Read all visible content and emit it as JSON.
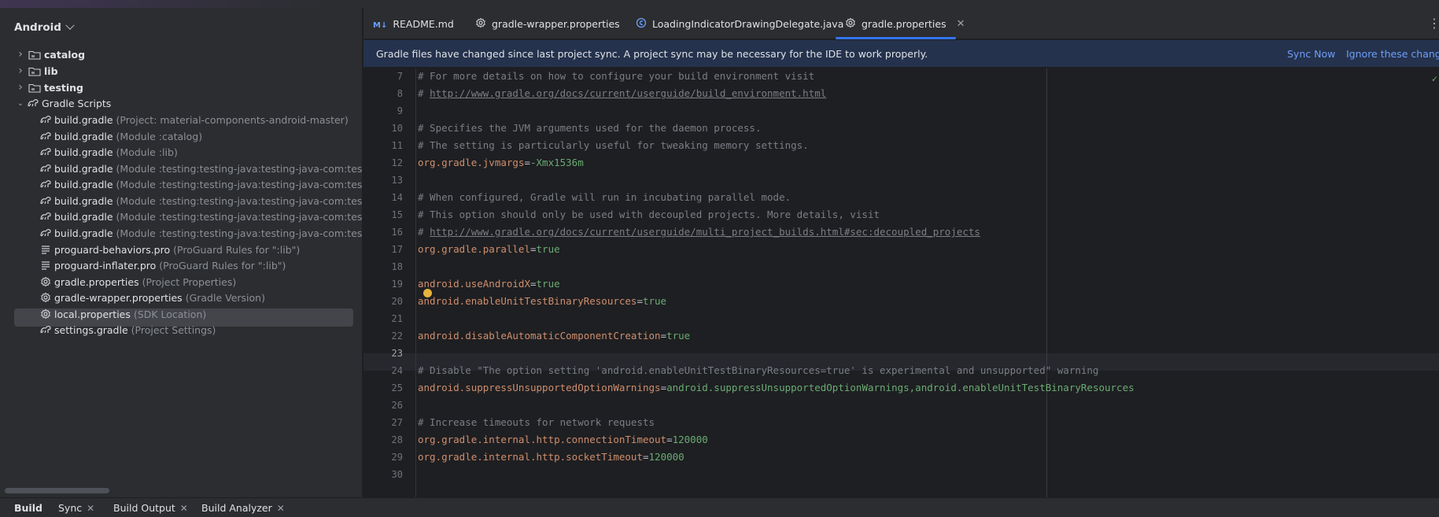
{
  "sidebar": {
    "view_label": "Android",
    "items": [
      {
        "name": "catalog",
        "hint": "",
        "kind": "folder"
      },
      {
        "name": "lib",
        "hint": "",
        "kind": "folder"
      },
      {
        "name": "testing",
        "hint": "",
        "kind": "folder"
      },
      {
        "name": "Gradle Scripts",
        "hint": "",
        "kind": "gradle-group"
      },
      {
        "name": "build.gradle",
        "hint": "(Project: material-components-android-master)",
        "kind": "gradle"
      },
      {
        "name": "build.gradle",
        "hint": "(Module :catalog)",
        "kind": "gradle"
      },
      {
        "name": "build.gradle",
        "hint": "(Module :lib)",
        "kind": "gradle"
      },
      {
        "name": "build.gradle",
        "hint": "(Module :testing:testing-java:testing-java-com:testing-java-",
        "kind": "gradle"
      },
      {
        "name": "build.gradle",
        "hint": "(Module :testing:testing-java:testing-java-com:testing-java-",
        "kind": "gradle"
      },
      {
        "name": "build.gradle",
        "hint": "(Module :testing:testing-java:testing-java-com:testing-java-",
        "kind": "gradle"
      },
      {
        "name": "build.gradle",
        "hint": "(Module :testing:testing-java:testing-java-com:testing-java-",
        "kind": "gradle"
      },
      {
        "name": "build.gradle",
        "hint": "(Module :testing:testing-java:testing-java-com:testing-java-",
        "kind": "gradle"
      },
      {
        "name": "proguard-behaviors.pro",
        "hint": "(ProGuard Rules for \":lib\")",
        "kind": "text"
      },
      {
        "name": "proguard-inflater.pro",
        "hint": "(ProGuard Rules for \":lib\")",
        "kind": "text"
      },
      {
        "name": "gradle.properties",
        "hint": "(Project Properties)",
        "kind": "settings"
      },
      {
        "name": "gradle-wrapper.properties",
        "hint": "(Gradle Version)",
        "kind": "settings"
      },
      {
        "name": "local.properties",
        "hint": "(SDK Location)",
        "kind": "settings"
      },
      {
        "name": "settings.gradle",
        "hint": "(Project Settings)",
        "kind": "gradle"
      }
    ],
    "selected_item": "gradle.properties"
  },
  "tabs": [
    {
      "label": "README.md",
      "icon": "markdown-icon",
      "active": false,
      "closable": false
    },
    {
      "label": "gradle-wrapper.properties",
      "icon": "settings-gear-icon",
      "active": false,
      "closable": false
    },
    {
      "label": "LoadingIndicatorDrawingDelegate.java",
      "icon": "java-class-icon",
      "active": false,
      "closable": false
    },
    {
      "label": "gradle.properties",
      "icon": "settings-gear-icon",
      "active": true,
      "closable": true
    }
  ],
  "banner": {
    "message": "Gradle files have changed since last project sync. A project sync may be necessary for the IDE to work properly.",
    "sync_now": "Sync Now",
    "ignore": "Ignore these changes"
  },
  "editor": {
    "current_line": 23,
    "lines": [
      {
        "n": "7",
        "segments": [
          [
            "c-comment",
            "# For more details on how to configure your build environment visit"
          ]
        ]
      },
      {
        "n": "8",
        "segments": [
          [
            "c-comment",
            "# "
          ],
          [
            "c-url",
            "http://www.gradle.org/docs/current/userguide/build_environment.html"
          ]
        ]
      },
      {
        "n": "9",
        "segments": []
      },
      {
        "n": "10",
        "segments": [
          [
            "c-comment",
            "# Specifies the JVM arguments used for the daemon process."
          ]
        ]
      },
      {
        "n": "11",
        "segments": [
          [
            "c-comment",
            "# The setting is particularly useful for tweaking memory settings."
          ]
        ]
      },
      {
        "n": "12",
        "segments": [
          [
            "c-key",
            "org.gradle.jvmargs"
          ],
          [
            "c-eq",
            "="
          ],
          [
            "c-val",
            "-Xmx1536m"
          ]
        ]
      },
      {
        "n": "13",
        "segments": []
      },
      {
        "n": "14",
        "segments": [
          [
            "c-comment",
            "# When configured, Gradle will run in incubating parallel mode."
          ]
        ]
      },
      {
        "n": "15",
        "segments": [
          [
            "c-comment",
            "# This option should only be used with decoupled projects. More details, visit"
          ]
        ]
      },
      {
        "n": "16",
        "segments": [
          [
            "c-comment",
            "# "
          ],
          [
            "c-url",
            "http://www.gradle.org/docs/current/userguide/multi_project_builds.html#sec:decoupled_projects"
          ]
        ]
      },
      {
        "n": "17",
        "segments": [
          [
            "c-key",
            "org.gradle.parallel"
          ],
          [
            "c-eq",
            "="
          ],
          [
            "c-val",
            "true"
          ]
        ]
      },
      {
        "n": "18",
        "segments": []
      },
      {
        "n": "19",
        "segments": [
          [
            "c-key",
            "android.useAndroidX"
          ],
          [
            "c-eq",
            "="
          ],
          [
            "c-val",
            "true"
          ]
        ]
      },
      {
        "n": "20",
        "segments": [
          [
            "c-key",
            "android.enableUnitTestBinaryResources"
          ],
          [
            "c-eq",
            "="
          ],
          [
            "c-val",
            "true"
          ]
        ]
      },
      {
        "n": "21",
        "segments": []
      },
      {
        "n": "22",
        "segments": [
          [
            "c-key",
            "android.disableAutomaticComponentCreation"
          ],
          [
            "c-eq",
            "="
          ],
          [
            "c-val",
            "true"
          ]
        ]
      },
      {
        "n": "23",
        "segments": []
      },
      {
        "n": "24",
        "segments": [
          [
            "c-comment",
            "# Disable \"The option setting 'android.enableUnitTestBinaryResources=true' is experimental and unsupported\" warning"
          ]
        ]
      },
      {
        "n": "25",
        "segments": [
          [
            "c-key",
            "android.suppressUnsupportedOptionWarnings"
          ],
          [
            "c-eq",
            "="
          ],
          [
            "c-val",
            "android.suppressUnsupportedOptionWarnings,android.enableUnitTestBinaryResources"
          ]
        ]
      },
      {
        "n": "26",
        "segments": []
      },
      {
        "n": "27",
        "segments": [
          [
            "c-comment",
            "# Increase timeouts for network requests"
          ]
        ]
      },
      {
        "n": "28",
        "segments": [
          [
            "c-key",
            "org.gradle.internal.http.connectionTimeout"
          ],
          [
            "c-eq",
            "="
          ],
          [
            "c-val",
            "120000"
          ]
        ]
      },
      {
        "n": "29",
        "segments": [
          [
            "c-key",
            "org.gradle.internal.http.socketTimeout"
          ],
          [
            "c-eq",
            "="
          ],
          [
            "c-val",
            "120000"
          ]
        ]
      },
      {
        "n": "30",
        "segments": []
      }
    ]
  },
  "bottom_tabs": [
    {
      "label": "Build",
      "active": true,
      "closable": false
    },
    {
      "label": "Sync",
      "active": false,
      "closable": true
    },
    {
      "label": "Build Output",
      "active": false,
      "closable": true
    },
    {
      "label": "Build Analyzer",
      "active": false,
      "closable": true
    }
  ],
  "colors": {
    "accent": "#3574f0",
    "link": "#6d9ef8",
    "banner_bg": "#25324d",
    "key": "#cf8e6d",
    "value": "#6aab73",
    "comment": "#7a7e85"
  }
}
